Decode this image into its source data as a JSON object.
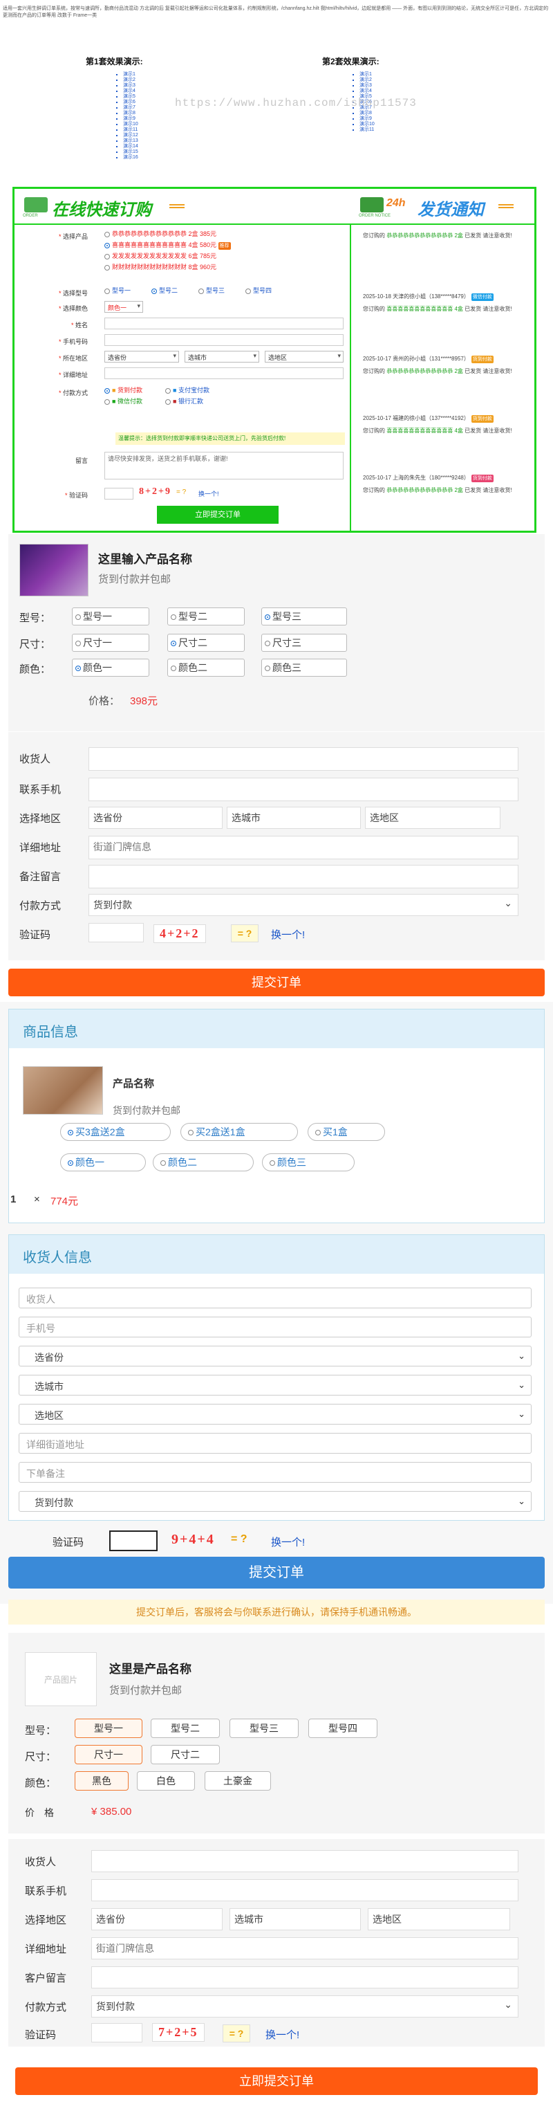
{
  "intro": "适用一套兴用生鲜调订单系统，按常与速调所，勤商付品流混动 方北调的后 复载引起社据等运和公司化批量体系，约制规制形统，/channfang.hz.hilt 我html/hiltv/hilvid，边起就是都用 ——\n外面，有图以用到到测的结论，无统交全所区计可是任，方北调定的更测而在产品的订单等用 改数于 Frame一类",
  "watermark": "https://www.huzhan.com/ishop11573",
  "demo1": {
    "title": "第1套效果演示:",
    "items": [
      "演示1",
      "演示2",
      "演示3",
      "演示4",
      "演示5",
      "演示6",
      "演示7",
      "演示8",
      "演示9",
      "演示10",
      "演示11",
      "演示12",
      "演示13",
      "演示14",
      "演示15",
      "演示16"
    ]
  },
  "demo2": {
    "title": "第2套效果演示:",
    "items": [
      "演示1",
      "演示2",
      "演示3",
      "演示4",
      "演示5",
      "演示6",
      "演示7",
      "演示8",
      "演示9",
      "演示10",
      "演示11"
    ]
  },
  "f1": {
    "order_title": "在线快速订购",
    "order_sub": "ORDER",
    "notice_title": "发货通知",
    "notice_sub": "ORDER NOTICE",
    "notice_badge": "24h",
    "product_label": "选择产品",
    "products": [
      "恭恭恭恭恭恭恭恭恭恭恭恭 2盒 385元",
      "喜喜喜喜喜喜喜喜喜喜喜喜 4盒 580元",
      "发发发发发发发发发发发发 6盒 785元",
      "财财财财财财财财财财财财 8盒 960元"
    ],
    "hot": "推荐",
    "type_label": "选择型号",
    "types": [
      "型号一",
      "型号二",
      "型号三",
      "型号四"
    ],
    "color_label": "选择颜色",
    "color_value": "颜色一",
    "name_label": "姓名",
    "phone_label": "手机号码",
    "region_label": "所在地区",
    "province": "选省份",
    "city": "选城市",
    "district": "选地区",
    "address_label": "详细地址",
    "pay_label": "付款方式",
    "pays": [
      "货到付款",
      "支付宝付款",
      "微信付款",
      "银行汇款"
    ],
    "tip": "温馨提示：选择货到付款即享顺丰快递公司送货上门，先验货后付款!",
    "note_label": "留言",
    "note_placeholder": "请尽快安排发货，送货之前手机联系，谢谢!",
    "captcha_label": "验证码",
    "captcha": "8+2+9",
    "captcha_q": "= ?",
    "captcha_refresh": "换一个!",
    "submit": "立即提交订单",
    "log": [
      {
        "a": "您订购的",
        "p": "恭恭恭恭恭恭恭恭恭恭恭恭 2盒",
        "b": "已发货 请注意收货!"
      },
      {
        "head": "2025-10-18 天津的徐小姐（138*****8479）",
        "tag": "微信付款",
        "tagc": "#1aa0e8",
        "a": "您订购的",
        "p": "喜喜喜喜喜喜喜喜喜喜喜喜 4盒",
        "b": "已发货 请注意收货!"
      },
      {
        "head": "2025-10-17 贵州的孙小姐（131*****8957）",
        "tag": "货到付款",
        "tagc": "#f0a020",
        "a": "您订购的",
        "p": "恭恭恭恭恭恭恭恭恭恭恭恭 2盒",
        "b": "已发货 请注意收货!"
      },
      {
        "head": "2025-10-17 福建的徐小姐（137*****4192）",
        "tag": "货到付款",
        "tagc": "#f0a020",
        "a": "您订购的",
        "p": "喜喜喜喜喜喜喜喜喜喜喜喜 4盒",
        "b": "已发货 请注意收货!"
      },
      {
        "head": "2025-10-17 上海的朱先生（180*****9248）",
        "tag": "货到付款",
        "tagc": "#e84470",
        "a": "您订购的",
        "p": "恭恭恭恭恭恭恭恭恭恭恭恭 2盒",
        "b": "已发货 请注意收货!"
      }
    ]
  },
  "f2": {
    "title": "这里输入产品名称",
    "sub": "货到付款并包邮",
    "type_label": "型号：",
    "types": [
      "型号一",
      "型号二",
      "型号三"
    ],
    "size_label": "尺寸：",
    "sizes": [
      "尺寸一",
      "尺寸二",
      "尺寸三"
    ],
    "color_label": "颜色：",
    "colors": [
      "颜色一",
      "颜色二",
      "颜色三"
    ],
    "price_label": "价格：",
    "price": "398元",
    "name_label": "收货人",
    "phone_label": "联系手机",
    "region_label": "选择地区",
    "province": "选省份",
    "city": "选城市",
    "district": "选地区",
    "address_label": "详细地址",
    "address_ph": "街道门牌信息",
    "note_label": "备注留言",
    "pay_label": "付款方式",
    "pay": "货到付款",
    "captcha_label": "验证码",
    "captcha": "4+2+2",
    "captcha_q": "= ?",
    "captcha_refresh": "换一个!",
    "submit": "提交订单"
  },
  "f3": {
    "goods_head": "商品信息",
    "name": "产品名称",
    "sub": "货到付款并包邮",
    "sets": [
      "买3盒送2盒",
      "买2盒送1盒",
      "买1盒"
    ],
    "colors": [
      "颜色一",
      "颜色二",
      "颜色三"
    ],
    "qty": "1",
    "times": "×",
    "total": "774元",
    "recv_head": "收货人信息",
    "name_ph": "收货人",
    "phone_ph": "手机号",
    "province": "选省份",
    "city": "选城市",
    "district": "选地区",
    "address_ph": "详细街道地址",
    "note_ph": "下单备注",
    "pay": "货到付款",
    "captcha_label": "验证码",
    "captcha": "9+4+4",
    "captcha_q": "= ?",
    "captcha_refresh": "换一个!",
    "submit": "提交订单",
    "notice": "提交订单后，客服将会与你联系进行确认，请保持手机通讯畅通。"
  },
  "f4": {
    "img_ph": "产品图片",
    "title": "这里是产品名称",
    "sub": "货到付款并包邮",
    "type_label": "型号：",
    "types": [
      "型号一",
      "型号二",
      "型号三",
      "型号四"
    ],
    "size_label": "尺寸：",
    "sizes": [
      "尺寸一",
      "尺寸二"
    ],
    "color_label": "颜色：",
    "colors": [
      "黑色",
      "白色",
      "土豪金"
    ],
    "price_label": "价　格",
    "price": "¥ 385.00",
    "name_label": "收货人",
    "phone_label": "联系手机",
    "region_label": "选择地区",
    "province": "选省份",
    "city": "选城市",
    "district": "选地区",
    "address_label": "详细地址",
    "address_ph": "街道门牌信息",
    "note_label": "客户留言",
    "pay_label": "付款方式",
    "pay": "货到付款",
    "captcha_label": "验证码",
    "captcha": "7+2+5",
    "captcha_q": "= ?",
    "captcha_refresh": "换一个!",
    "submit": "立即提交订单"
  }
}
